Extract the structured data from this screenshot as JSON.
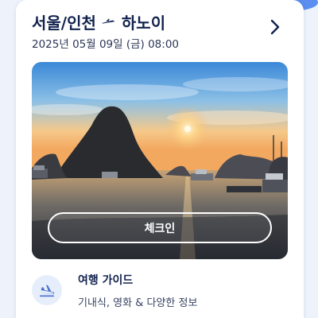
{
  "trip": {
    "origin": "서울/인천",
    "destination": "하노이",
    "datetime": "2025년 05월 09일 (금) 08:00"
  },
  "checkin": {
    "label": "체크인"
  },
  "guide": {
    "title": "여행 가이드",
    "subtitle": "기내식, 영화 & 다양한 정보"
  },
  "icons": {
    "plane": "airplane-icon",
    "chevron": "chevron-right-icon",
    "guide": "airplane-landing-icon"
  },
  "colors": {
    "brand_dark": "#12224e",
    "accent_blue": "#2f6fe0",
    "card_bg": "#ffffff",
    "page_bg": "#eef3fb"
  }
}
